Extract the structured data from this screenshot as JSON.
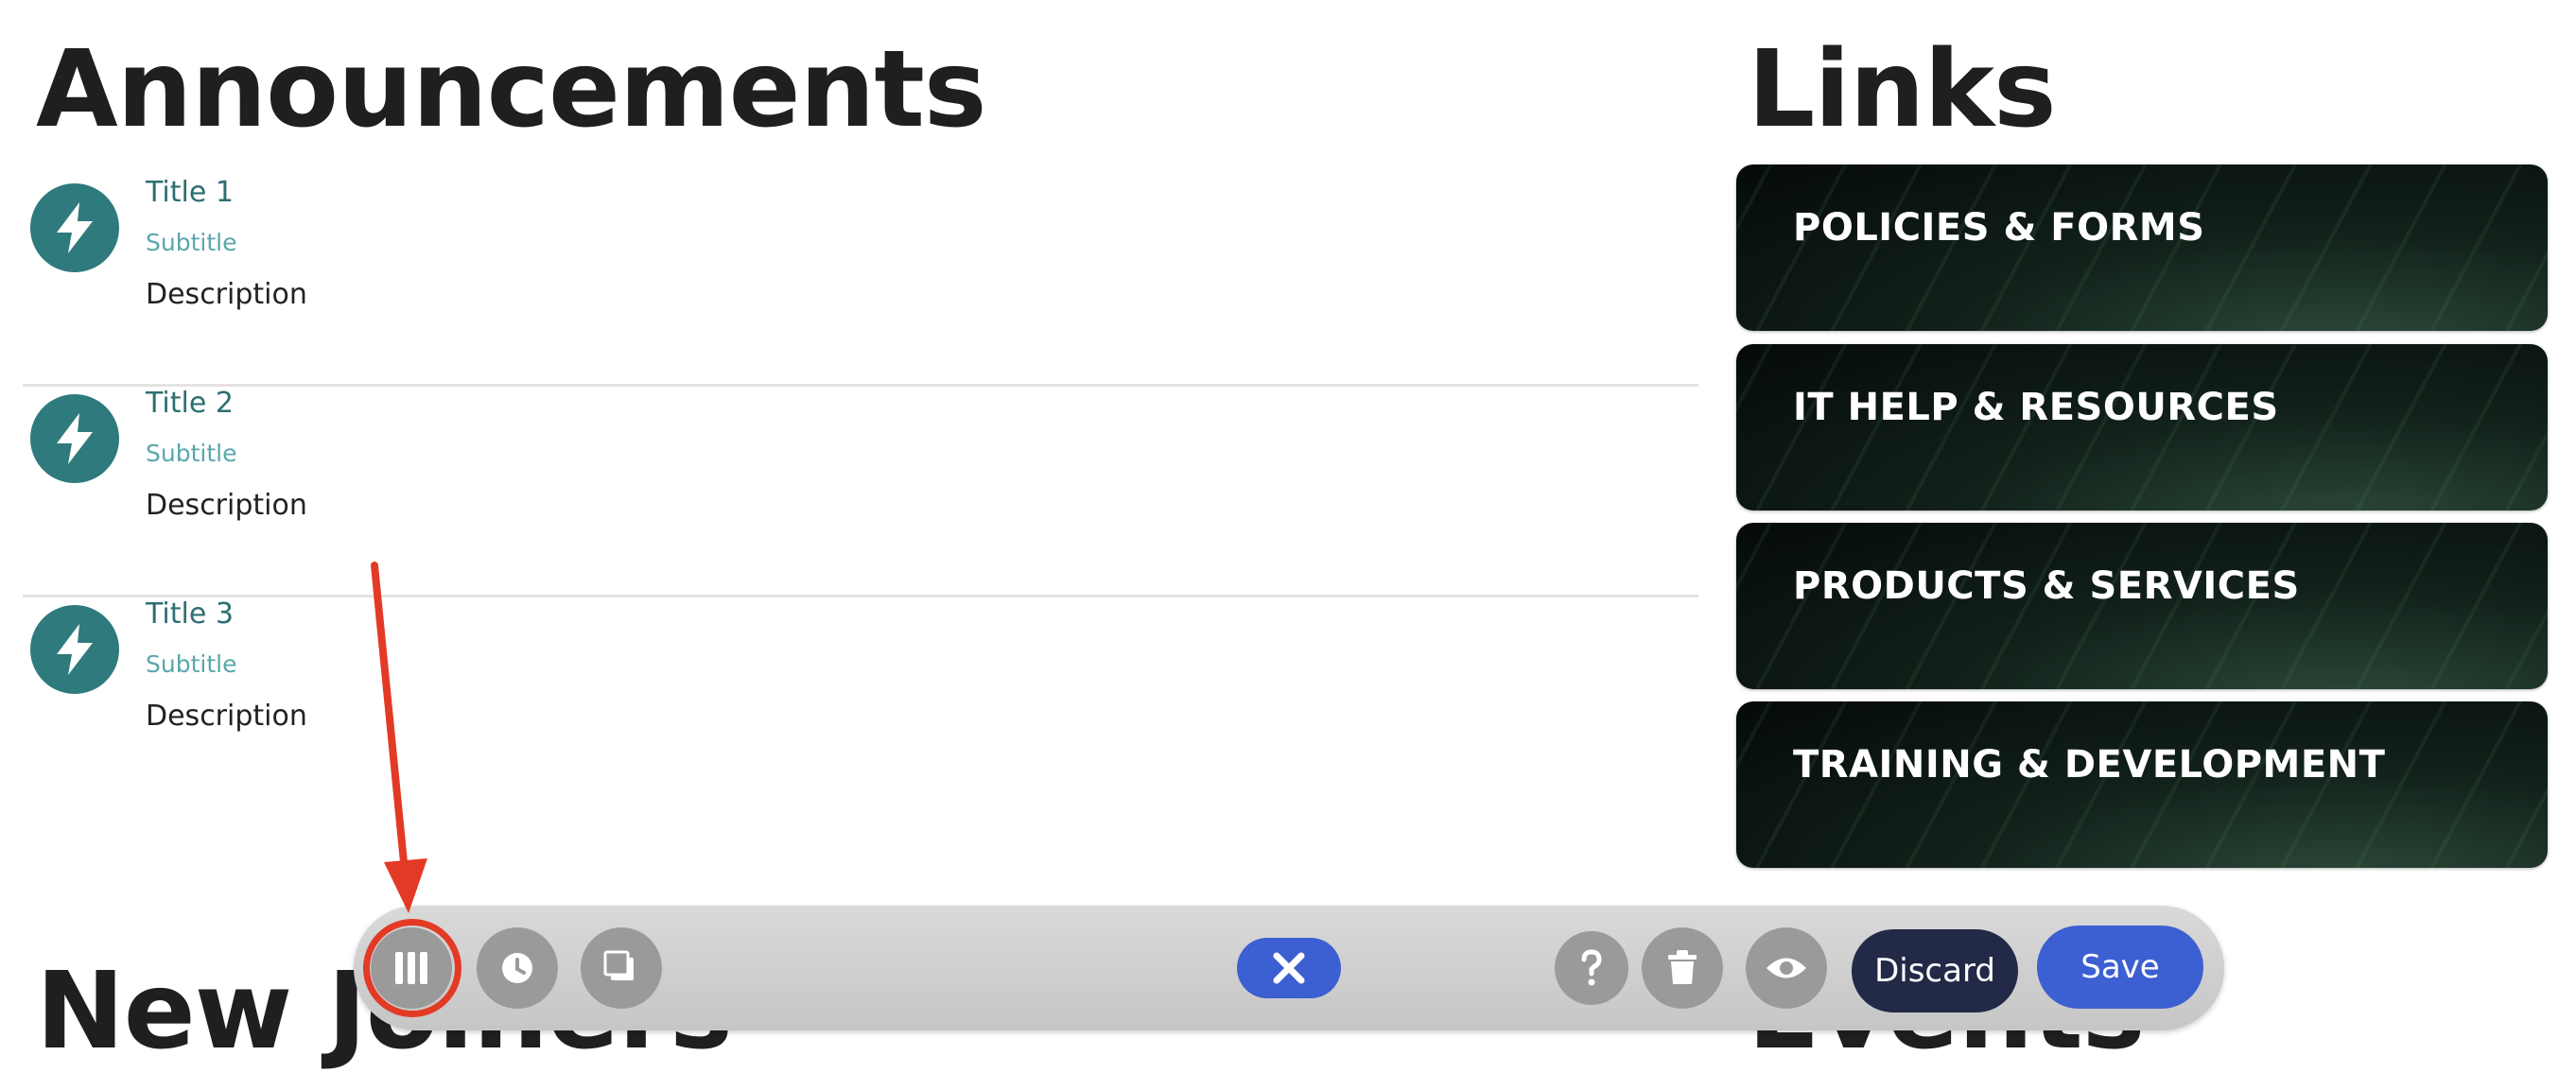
{
  "announcements": {
    "heading": "Announcements",
    "items": [
      {
        "title": "Title 1",
        "subtitle": "Subtitle",
        "description": "Description"
      },
      {
        "title": "Title 2",
        "subtitle": "Subtitle",
        "description": "Description"
      },
      {
        "title": "Title 3",
        "subtitle": "Subtitle",
        "description": "Description"
      }
    ],
    "icon": "lightning-icon"
  },
  "links": {
    "heading": "Links",
    "items": [
      {
        "label": "POLICIES & FORMS"
      },
      {
        "label": "IT HELP & RESOURCES"
      },
      {
        "label": "PRODUCTS & SERVICES"
      },
      {
        "label": "TRAINING & DEVELOPMENT"
      }
    ]
  },
  "below_fold": {
    "new_joiners_heading": "New Joiners",
    "events_heading": "Events"
  },
  "toolbar": {
    "discard_label": "Discard",
    "save_label": "Save",
    "icons": [
      "columns-icon",
      "clock-icon",
      "layers-icon",
      "close-icon",
      "help-icon",
      "trash-icon",
      "eye-icon"
    ]
  },
  "colors": {
    "accent": "#2e7a7c",
    "primary_button": "#3c5fd1",
    "discard_button": "#222a47",
    "highlight": "#e33a26"
  }
}
